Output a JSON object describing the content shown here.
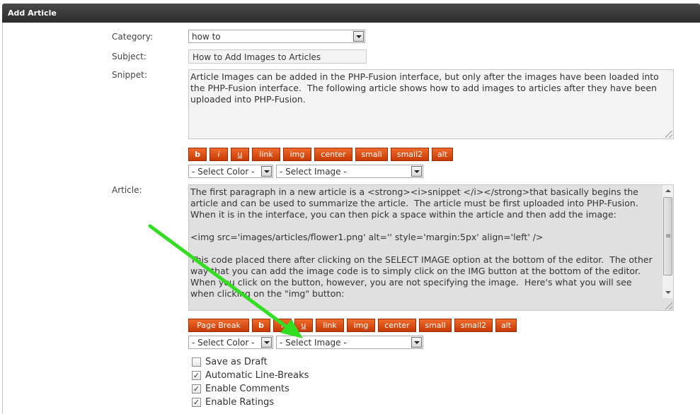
{
  "panel": {
    "title": "Add Article"
  },
  "fields": {
    "category": {
      "label": "Category:",
      "value": "how to"
    },
    "subject": {
      "label": "Subject:",
      "value": "How to Add Images to Articles"
    },
    "snippet": {
      "label": "Snippet:",
      "value": "Article Images can be added in the PHP-Fusion interface, but only after the images have been loaded into\nthe PHP-Fusion interface.  The following article shows how to add images to articles after they have been\nuploaded into PHP-Fusion."
    },
    "article": {
      "label": "Article:",
      "value": "The first paragraph in a new article is a <strong><i>snippet </i></strong>that basically begins the\narticle and can be used to summarize the article.  The article must be first uploaded into PHP-Fusion.\nWhen it is in the interface, you can then pick a space within the article and then add the image:\n\n<img src='images/articles/flower1.png' alt='' style='margin:5px' align='left' />\n\nThis code placed there after clicking on the SELECT IMAGE option at the bottom of the editor.  The other\nway that you can add the image code is to simply click on the IMG button at the bottom of the editor.\nWhen you click on the button, however, you are not specifying the image.  Here's what you will see\nwhen clicking on the \"img\" button:"
    }
  },
  "snippet_toolbar": {
    "buttons": [
      "b",
      "i",
      "u",
      "link",
      "img",
      "center",
      "small",
      "small2",
      "alt"
    ],
    "select_color": "- Select Color -",
    "select_image": "- Select Image -"
  },
  "article_toolbar": {
    "buttons": [
      "Page Break",
      "b",
      "i",
      "u",
      "link",
      "img",
      "center",
      "small",
      "small2",
      "alt"
    ],
    "select_color": "- Select Color -",
    "select_image": "- Select Image -"
  },
  "options": [
    {
      "label": "Save as Draft",
      "checked": false
    },
    {
      "label": "Automatic Line-Breaks",
      "checked": true
    },
    {
      "label": "Enable Comments",
      "checked": true
    },
    {
      "label": "Enable Ratings",
      "checked": true
    }
  ],
  "colors": {
    "header": "#333333",
    "button": "#dd4f10",
    "arrow": "#33dd22"
  }
}
